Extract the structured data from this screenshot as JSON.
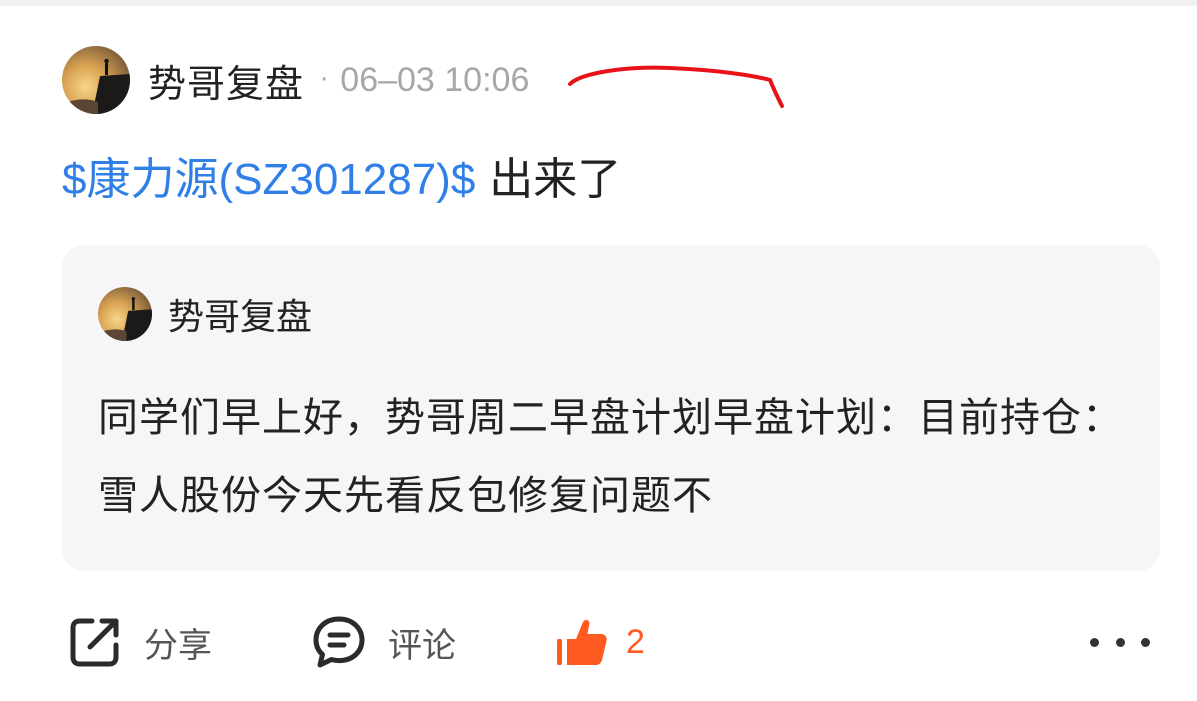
{
  "post": {
    "author": "势哥复盘",
    "dot": "·",
    "time": "06–03 10:06",
    "stock_link": "$康力源(SZ301287)$",
    "text": " 出来了"
  },
  "quote": {
    "author": "势哥复盘",
    "text": "同学们早上好，势哥周二早盘计划早盘计划：目前持仓：雪人股份今天先看反包修复问题不"
  },
  "actions": {
    "share_label": "分享",
    "comment_label": "评论",
    "like_count": "2"
  },
  "colors": {
    "link": "#2f7fe6",
    "like": "#ff5a1f",
    "annotation": "#e8121a",
    "card_bg": "#f6f6f8"
  },
  "icons": {
    "share": "share-icon",
    "comment": "comment-icon",
    "like": "thumbs-up-icon",
    "more": "more-dots-icon"
  }
}
